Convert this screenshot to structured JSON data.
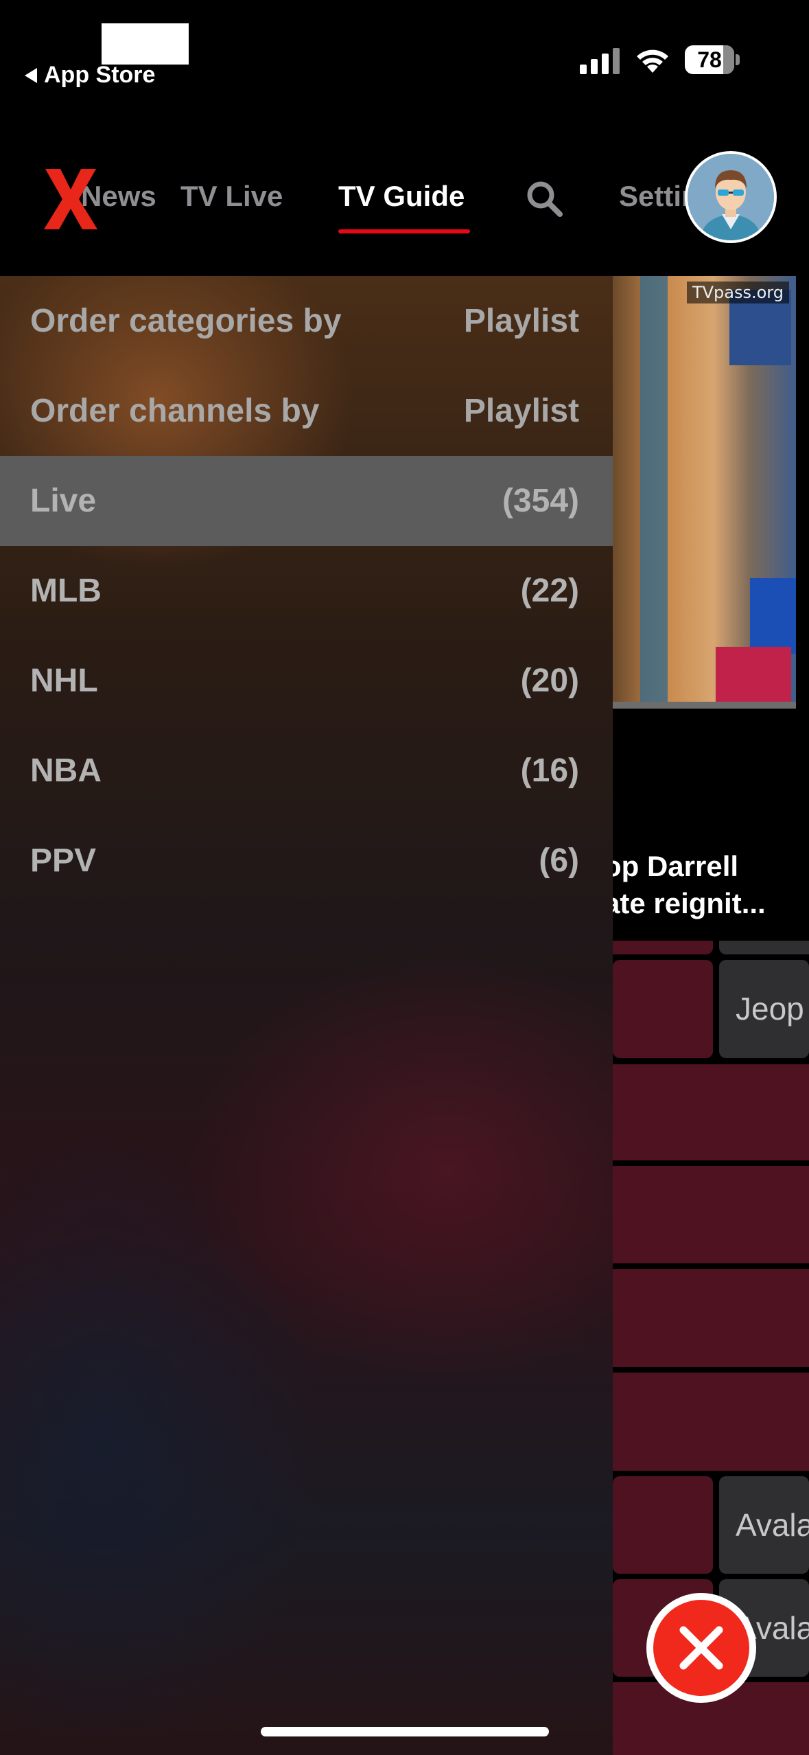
{
  "status_bar": {
    "back_label": "App Store",
    "battery": "78"
  },
  "nav": {
    "tabs": [
      {
        "label": "News"
      },
      {
        "label": "TV Live"
      },
      {
        "label": "TV Guide"
      },
      {
        "label": "Settings"
      }
    ],
    "active_tab": "TV Guide",
    "accent_color": "#e50914"
  },
  "preview": {
    "watermark": "TVpass.org",
    "program_line1": "op Darrell",
    "program_line2": "ate reignit..."
  },
  "grid": {
    "cells": [
      {
        "label": "Jeop"
      },
      {
        "label": "Avala"
      },
      {
        "label": "Avala"
      }
    ]
  },
  "drawer": {
    "options": [
      {
        "label": "Order categories by",
        "value": "Playlist"
      },
      {
        "label": "Order channels by",
        "value": "Playlist"
      }
    ],
    "categories": [
      {
        "label": "Live",
        "count": "(354)",
        "selected": true
      },
      {
        "label": "MLB",
        "count": "(22)",
        "selected": false
      },
      {
        "label": "NHL",
        "count": "(20)",
        "selected": false
      },
      {
        "label": "NBA",
        "count": "(16)",
        "selected": false
      },
      {
        "label": "PPV",
        "count": "(6)",
        "selected": false
      }
    ]
  }
}
